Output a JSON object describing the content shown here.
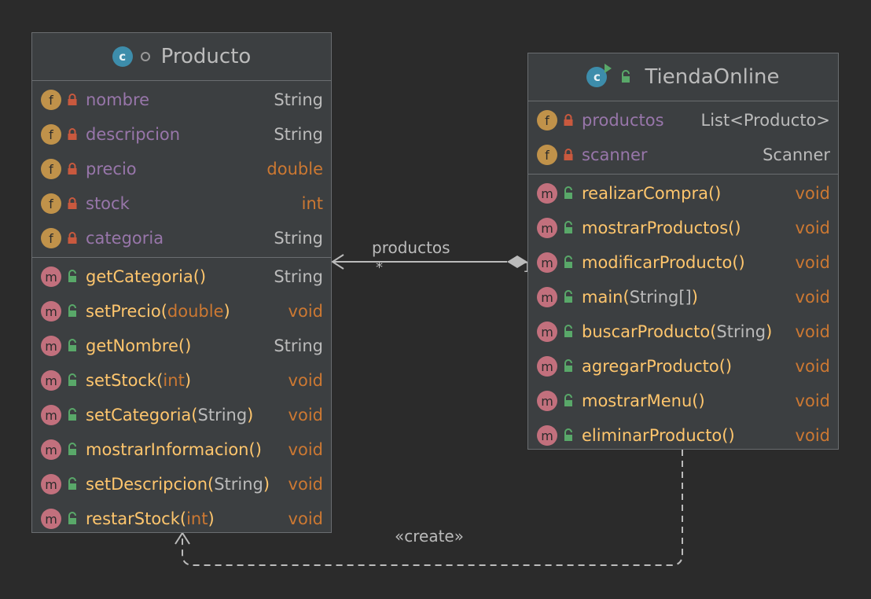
{
  "producto": {
    "name": "Producto",
    "fields": [
      {
        "name": "nombre",
        "type": "String"
      },
      {
        "name": "descripcion",
        "type": "String"
      },
      {
        "name": "precio",
        "type": "double"
      },
      {
        "name": "stock",
        "type": "int"
      },
      {
        "name": "categoria",
        "type": "String"
      }
    ],
    "methods": [
      {
        "name": "getCategoria",
        "params": "",
        "ret": "String"
      },
      {
        "name": "setPrecio",
        "params": "double",
        "ret": "void"
      },
      {
        "name": "getNombre",
        "params": "",
        "ret": "String"
      },
      {
        "name": "setStock",
        "params": "int",
        "ret": "void"
      },
      {
        "name": "setCategoria",
        "params": "String",
        "ret": "void"
      },
      {
        "name": "mostrarInformacion",
        "params": "",
        "ret": "void"
      },
      {
        "name": "setDescripcion",
        "params": "String",
        "ret": "void"
      },
      {
        "name": "restarStock",
        "params": "int",
        "ret": "void"
      }
    ]
  },
  "tienda": {
    "name": "TiendaOnline",
    "fields": [
      {
        "name": "productos",
        "type": "List<Producto>"
      },
      {
        "name": "scanner",
        "type": "Scanner"
      }
    ],
    "methods": [
      {
        "name": "realizarCompra",
        "params": "",
        "ret": "void"
      },
      {
        "name": "mostrarProductos",
        "params": "",
        "ret": "void"
      },
      {
        "name": "modificarProducto",
        "params": "",
        "ret": "void"
      },
      {
        "name": "main",
        "params": "String[]",
        "ret": "void"
      },
      {
        "name": "buscarProducto",
        "params": "String",
        "ret": "void"
      },
      {
        "name": "agregarProducto",
        "params": "",
        "ret": "void"
      },
      {
        "name": "mostrarMenu",
        "params": "",
        "ret": "void"
      },
      {
        "name": "eliminarProducto",
        "params": "",
        "ret": "void"
      }
    ]
  },
  "relations": {
    "association_label": "productos",
    "multiplicity_many": "*",
    "multiplicity_one": "1",
    "dependency_label": "«create»"
  },
  "icons": {
    "class_letter": "c",
    "field_letter": "f",
    "method_letter": "m"
  },
  "colors": {
    "background": "#2b2b2b",
    "box": "#3c3f41",
    "field_name": "#9876aa",
    "method_name": "#ffc66d",
    "primitive": "#cc7832",
    "field_badge": "#c0924a",
    "method_badge": "#c2707d",
    "class_badge": "#3d8dab"
  }
}
